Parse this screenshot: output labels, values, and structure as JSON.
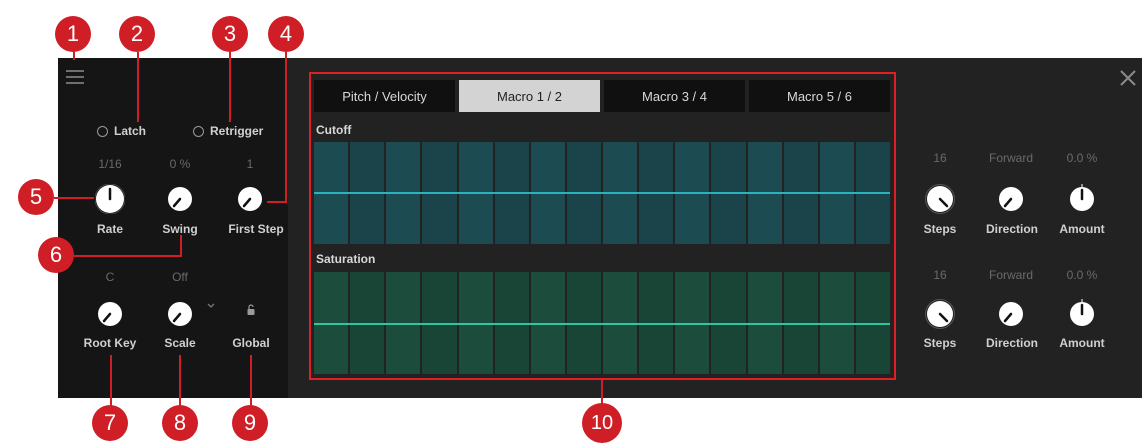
{
  "callouts": [
    "1",
    "2",
    "3",
    "4",
    "5",
    "6",
    "7",
    "8",
    "9",
    "10"
  ],
  "toggles": {
    "latch": "Latch",
    "retrigger": "Retrigger"
  },
  "knobs": {
    "rate": {
      "label": "Rate",
      "value": "1/16"
    },
    "swing": {
      "label": "Swing",
      "value": "0 %"
    },
    "first_step": {
      "label": "First Step",
      "value": "1"
    },
    "root_key": {
      "label": "Root Key",
      "value": "C"
    },
    "scale": {
      "label": "Scale",
      "value": "Off"
    },
    "global": {
      "label": "Global"
    }
  },
  "tabs": [
    "Pitch / Velocity",
    "Macro 1 / 2",
    "Macro 3 / 4",
    "Macro 5 / 6"
  ],
  "active_tab": "Macro 1 / 2",
  "lanes": [
    {
      "title": "Cutoff",
      "steps": "16",
      "direction": "Forward",
      "amount": "0.0 %"
    },
    {
      "title": "Saturation",
      "steps": "16",
      "direction": "Forward",
      "amount": "0.0 %"
    }
  ],
  "lane_labels": {
    "steps": "Steps",
    "direction": "Direction",
    "amount": "Amount"
  },
  "step_count": 16,
  "colors": {
    "accent": "#cf1e26",
    "cutoff_line": "#2ab3be",
    "saturation_line": "#2dc6a0",
    "cutoff_cells": "#1d4b52",
    "saturation_cells": "#1c4c3c"
  },
  "icons": {
    "menu": "menu-icon",
    "close": "close-icon",
    "scale_dropdown": "chevron-down-icon",
    "global_lock": "lock-icon"
  }
}
